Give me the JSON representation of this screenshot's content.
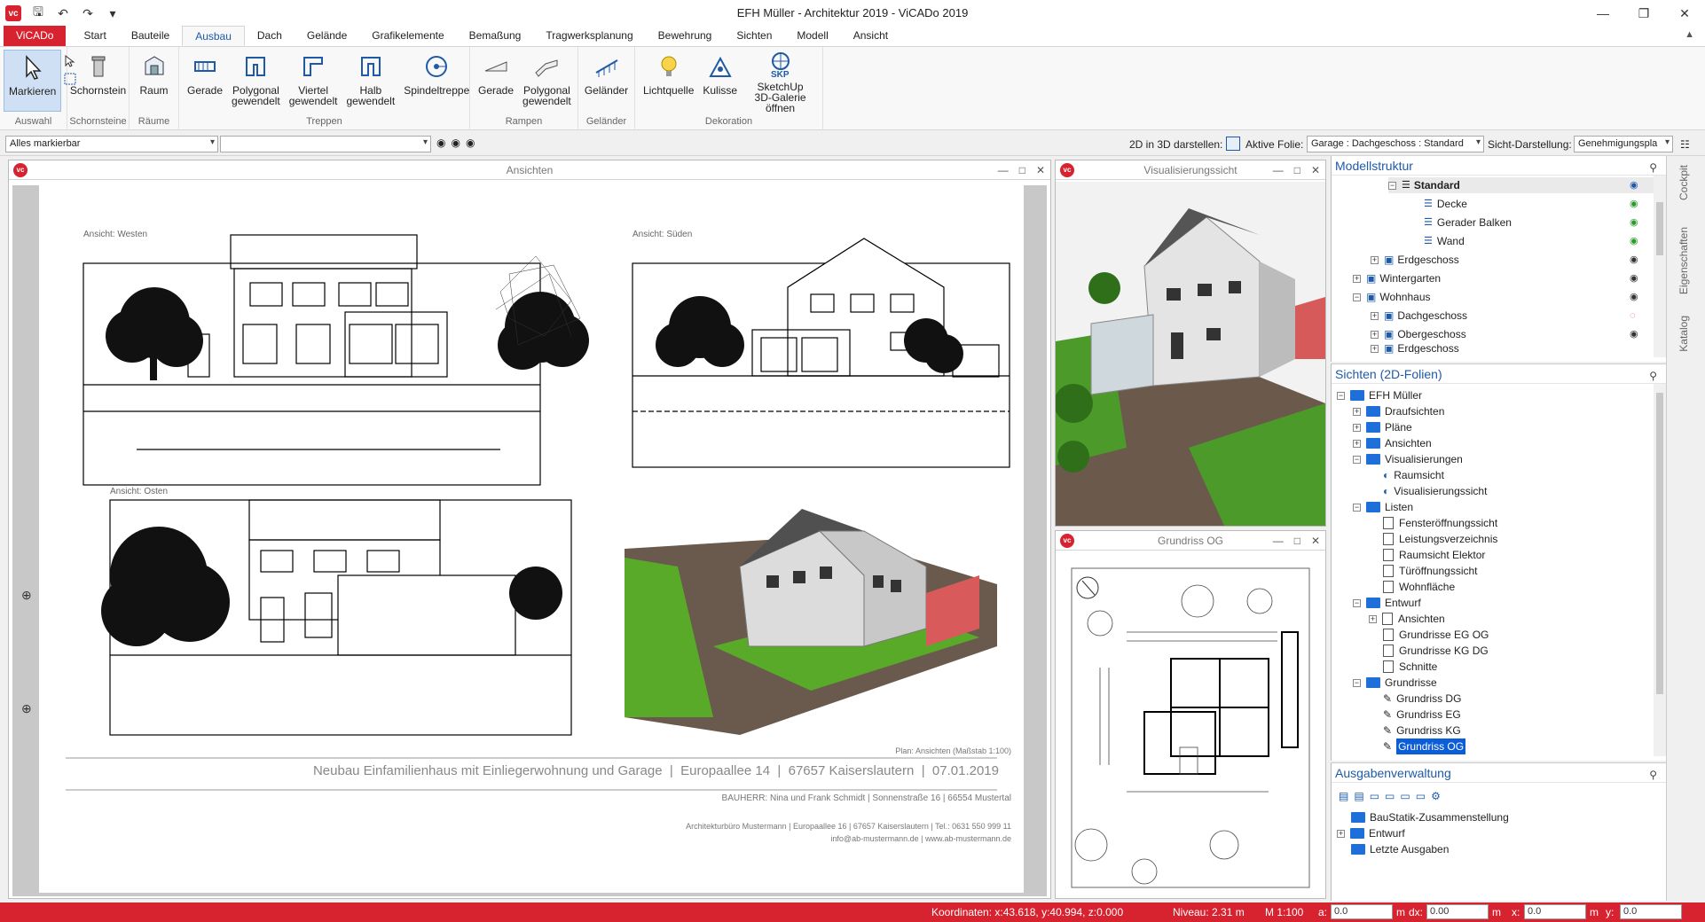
{
  "title": "EFH Müller - Architektur 2019 - ViCADo 2019",
  "tabs": [
    "ViCADo",
    "Start",
    "Bauteile",
    "Ausbau",
    "Dach",
    "Gelände",
    "Grafikelemente",
    "Bemaßung",
    "Tragwerksplanung",
    "Bewehrung",
    "Sichten",
    "Modell",
    "Ansicht"
  ],
  "ribbon": {
    "auswahl": {
      "label": "Auswahl",
      "markieren": "Markieren"
    },
    "schornsteine": {
      "label": "Schornsteine",
      "schornstein": "Schornstein"
    },
    "raeume": {
      "label": "Räume",
      "raum": "Raum"
    },
    "treppen": {
      "label": "Treppen",
      "gerade": "Gerade",
      "polygonal": "Polygonal",
      "polygonal2": "gewendelt",
      "viertel": "Viertel",
      "viertel2": "gewendelt",
      "halb": "Halb",
      "halb2": "gewendelt",
      "spindel": "Spindeltreppe"
    },
    "rampen": {
      "label": "Rampen",
      "gerade": "Gerade",
      "polygonal": "Polygonal",
      "polygonal2": "gewendelt"
    },
    "gelaender": {
      "label": "Geländer",
      "gelaender": "Geländer"
    },
    "dekoration": {
      "label": "Dekoration",
      "lichtquelle": "Lichtquelle",
      "kulisse": "Kulisse",
      "sketchup": "SketchUp",
      "sketchup2": "3D-Galerie öffnen"
    }
  },
  "filterbar": {
    "selection": "Alles markierbar",
    "search": "",
    "label_2d3d": "2D in 3D darstellen:",
    "label_folie": "Aktive Folie:",
    "folie": "Garage : Dachgeschoss : Standard",
    "label_sicht": "Sicht-Darstellung:",
    "sicht": "Genehmigungspla"
  },
  "panels": {
    "ansichten": "Ansichten",
    "visual": "Visualisierungssicht",
    "grundriss": "Grundriss OG"
  },
  "sheet": {
    "westen": "Ansicht: Westen",
    "sueden": "Ansicht: Süden",
    "osten": "Ansicht: Osten",
    "plan": "Plan: Ansichten (Maßstab 1:100)",
    "project": "Neubau Einfamilienhaus mit Einliegerwohnung und Garage  |  Europaallee 14  |  67657 Kaiserslautern  |  07.01.2019",
    "bauherr": "BAUHERR: Nina und Frank Schmidt | Sonnenstraße 16 | 66554 Mustertal",
    "architect": "Architekturbüro Mustermann | Europaallee 16 | 67657 Kaiserslautern | Tel.: 0631 550 999 11",
    "contact": "info@ab-mustermann.de | www.ab-mustermann.de"
  },
  "modellstruktur": {
    "title": "Modellstruktur",
    "items": [
      {
        "label": "Standard",
        "bold": true
      },
      {
        "label": "Decke"
      },
      {
        "label": "Gerader Balken"
      },
      {
        "label": "Wand"
      },
      {
        "label": "Erdgeschoss"
      },
      {
        "label": "Wintergarten"
      },
      {
        "label": "Wohnhaus"
      },
      {
        "label": "Dachgeschoss"
      },
      {
        "label": "Obergeschoss"
      },
      {
        "label": "Erdgeschoss"
      }
    ]
  },
  "sichten": {
    "title": "Sichten (2D-Folien)",
    "items": [
      "EFH Müller",
      "Draufsichten",
      "Pläne",
      "Ansichten",
      "Visualisierungen",
      "Raumsicht",
      "Visualisierungssicht",
      "Listen",
      "Fensteröffnungssicht",
      "Leistungsverzeichnis",
      "Raumsicht Elektor",
      "Türöffnungssicht",
      "Wohnfläche",
      "Entwurf",
      "Ansichten",
      "Grundrisse EG OG",
      "Grundrisse KG DG",
      "Schnitte",
      "Grundrisse",
      "Grundriss DG",
      "Grundriss EG",
      "Grundriss KG",
      "Grundriss OG"
    ]
  },
  "ausgaben": {
    "title": "Ausgabenverwaltung",
    "items": [
      "BauStatik-Zusammenstellung",
      "Entwurf",
      "Letzte Ausgaben"
    ]
  },
  "sidetabs": [
    "Cockpit",
    "Eigenschaften",
    "Katalog"
  ],
  "status": {
    "coords": "Koordinaten: x:43.618, y:40.994, z:0.000",
    "niveau": "Niveau: 2.31 m",
    "scale": "M 1:100",
    "a_label": "a:",
    "a": "0.0",
    "m1": "m",
    "dx_label": "dx:",
    "dx": "0.00",
    "m2": "m",
    "x_label": "x:",
    "x": "0.0",
    "m3": "m",
    "y_label": "y:",
    "y": "0.0"
  },
  "colors": {
    "brand": "#d7232f",
    "accent": "#1e5aa8",
    "selection": "#0b5ed7"
  }
}
